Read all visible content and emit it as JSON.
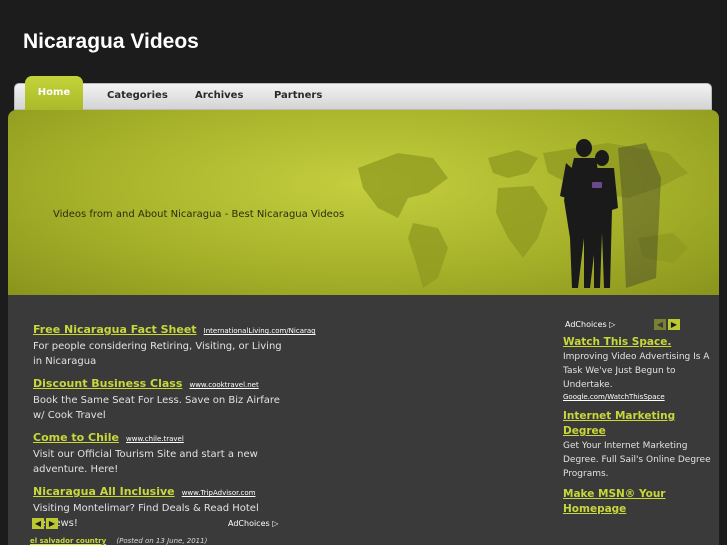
{
  "site": {
    "title": "Nicaragua Videos",
    "tagline": "Videos from and About Nicaragua - Best Nicaragua Videos"
  },
  "nav": {
    "items": [
      {
        "label": "Home",
        "active": true
      },
      {
        "label": "Categories"
      },
      {
        "label": "Archives"
      },
      {
        "label": "Partners"
      }
    ]
  },
  "ads_left": [
    {
      "title": "Free Nicaragua Fact Sheet",
      "url": "InternationalLiving.com/Nicarag",
      "desc": "For people considering Retiring, Visiting, or Living in Nicaragua"
    },
    {
      "title": "Discount Business Class",
      "url": "www.cooktravel.net",
      "desc": "Book the Same Seat For Less. Save on Biz Airfare w/ Cook Travel"
    },
    {
      "title": "Come to Chile",
      "url": "www.chile.travel",
      "desc": "Visit our Official Tourism Site and start a new adventure. Here!"
    },
    {
      "title": "Nicaragua All Inclusive",
      "url": "www.TripAdvisor.com",
      "desc": "Visiting Montelimar? Find Deals & Read Hotel Reviews!"
    }
  ],
  "adchoices_label": "AdChoices",
  "arrows": {
    "prev": "◀",
    "next": "▶"
  },
  "post_meta": {
    "category": "el salvador country",
    "posted": "(Posted on 13 June, 2011)"
  },
  "ads_right": [
    {
      "title": "Watch This Space.",
      "desc": "Improving Video Advertising Is A Task We've Just Begun to Undertake.",
      "url": "Google.com/WatchThisSpace"
    },
    {
      "title": "Internet Marketing Degree",
      "desc": "Get Your Internet Marketing Degree. Full Sail's Online Degree Programs.",
      "url": ""
    },
    {
      "title": "Make MSN® Your Homepage",
      "desc": "",
      "url": ""
    }
  ],
  "colors": {
    "accent": "#c8d83a",
    "background": "#1c1c1c",
    "content_bg": "#3a3a3a",
    "header_band": "#a7b22a"
  }
}
